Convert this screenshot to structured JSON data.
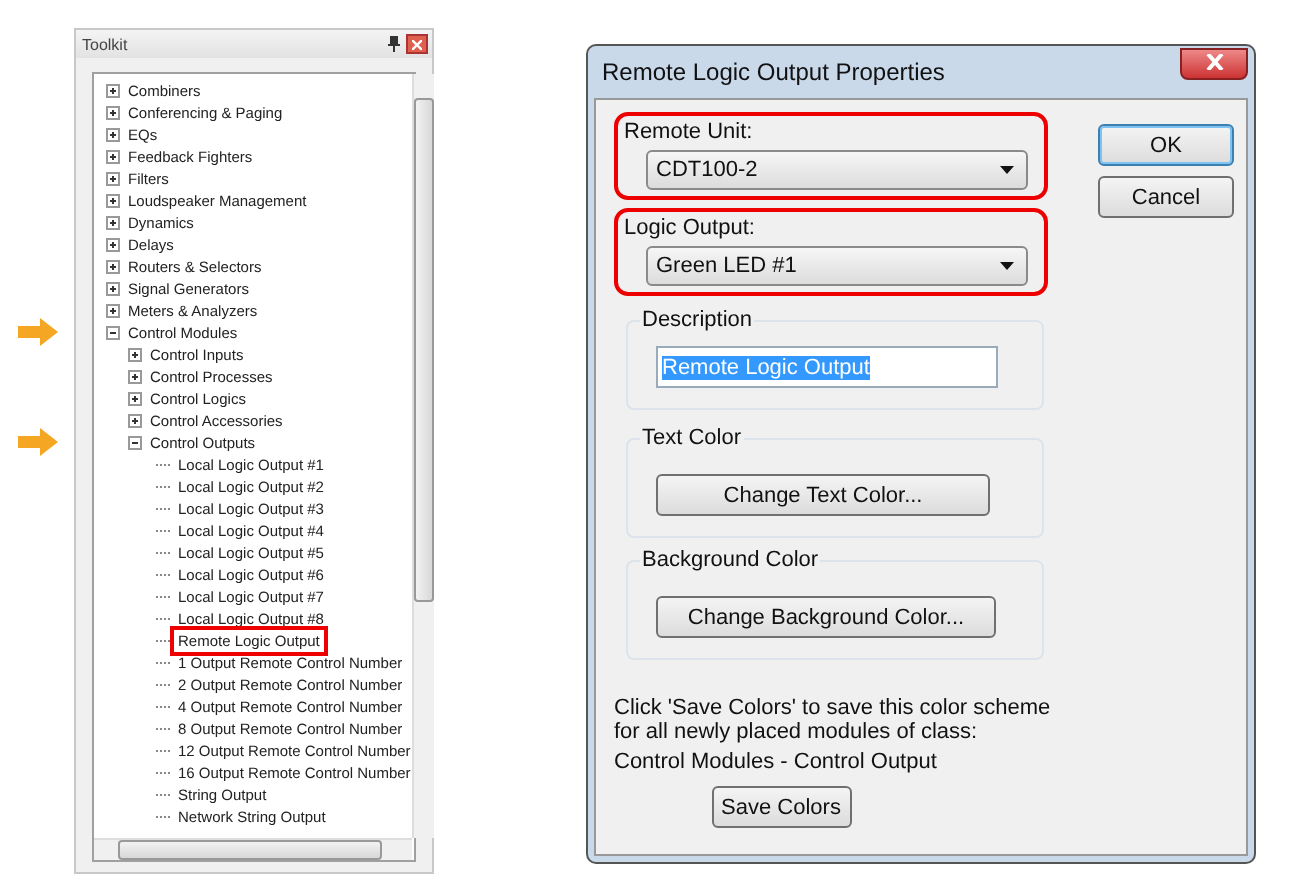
{
  "toolkit": {
    "title": "Toolkit",
    "tree": [
      {
        "label": "Combiners",
        "expanded": false,
        "callout": false
      },
      {
        "label": "Conferencing & Paging",
        "expanded": false,
        "callout": false
      },
      {
        "label": "EQs",
        "expanded": false,
        "callout": false
      },
      {
        "label": "Feedback Fighters",
        "expanded": false,
        "callout": false
      },
      {
        "label": "Filters",
        "expanded": false,
        "callout": false
      },
      {
        "label": "Loudspeaker Management",
        "expanded": false,
        "callout": false
      },
      {
        "label": "Dynamics",
        "expanded": false,
        "callout": false
      },
      {
        "label": "Delays",
        "expanded": false,
        "callout": false
      },
      {
        "label": "Routers & Selectors",
        "expanded": false,
        "callout": false
      },
      {
        "label": "Signal Generators",
        "expanded": false,
        "callout": false
      },
      {
        "label": "Meters & Analyzers",
        "expanded": false,
        "callout": false
      },
      {
        "label": "Control Modules",
        "expanded": true,
        "callout": true,
        "children": [
          {
            "label": "Control Inputs",
            "expanded": false,
            "callout": false
          },
          {
            "label": "Control Processes",
            "expanded": false,
            "callout": false
          },
          {
            "label": "Control Logics",
            "expanded": false,
            "callout": false
          },
          {
            "label": "Control Accessories",
            "expanded": false,
            "callout": false
          },
          {
            "label": "Control Outputs",
            "expanded": true,
            "callout": true,
            "children": [
              {
                "label": "Local Logic Output #1",
                "highlighted": false
              },
              {
                "label": "Local Logic Output #2",
                "highlighted": false
              },
              {
                "label": "Local Logic Output #3",
                "highlighted": false
              },
              {
                "label": "Local Logic Output #4",
                "highlighted": false
              },
              {
                "label": "Local Logic Output #5",
                "highlighted": false
              },
              {
                "label": "Local Logic Output #6",
                "highlighted": false
              },
              {
                "label": "Local Logic Output #7",
                "highlighted": false
              },
              {
                "label": "Local Logic Output #8",
                "highlighted": false
              },
              {
                "label": "Remote Logic Output",
                "highlighted": true
              },
              {
                "label": "1 Output Remote Control Number",
                "highlighted": false
              },
              {
                "label": "2 Output Remote Control Number",
                "highlighted": false
              },
              {
                "label": "4 Output Remote Control Number",
                "highlighted": false
              },
              {
                "label": "8 Output Remote Control Number",
                "highlighted": false
              },
              {
                "label": "12 Output Remote Control Number",
                "highlighted": false
              },
              {
                "label": "16 Output Remote Control Number",
                "highlighted": false
              },
              {
                "label": "String Output",
                "highlighted": false
              },
              {
                "label": "Network String Output",
                "highlighted": false
              }
            ]
          }
        ]
      }
    ]
  },
  "dialog": {
    "title": "Remote Logic Output Properties",
    "fields": [
      {
        "label": "Remote Unit:",
        "value": "CDT100-2",
        "highlighted": true
      },
      {
        "label": "Logic Output:",
        "value": "Green LED #1",
        "highlighted": true
      }
    ],
    "buttons": [
      "OK",
      "Cancel"
    ],
    "description": {
      "label": "Description",
      "value": "Remote Logic Output"
    },
    "color_groups": [
      {
        "label": "Text Color",
        "button": "Change Text Color..."
      },
      {
        "label": "Background Color",
        "button": "Change Background Color..."
      }
    ],
    "note_lines": [
      "Click 'Save Colors' to save this color scheme",
      "for all newly placed modules of class:"
    ],
    "class_name": "Control Modules - Control Output",
    "save_button": "Save Colors"
  }
}
